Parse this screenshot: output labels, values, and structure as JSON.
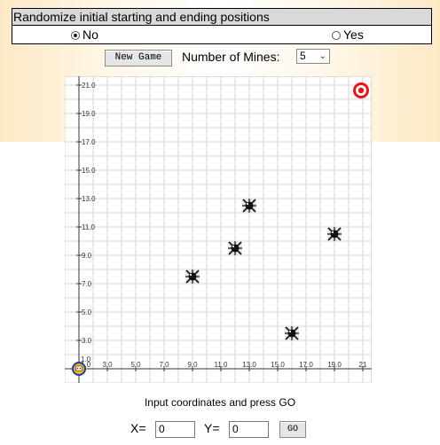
{
  "header": {
    "title": "Randomize initial starting and ending positions",
    "options": [
      {
        "label": "No",
        "checked": true
      },
      {
        "label": "Yes",
        "checked": false
      }
    ]
  },
  "toolbar": {
    "new_game_label": "New Game",
    "mines_label": "Number of Mines:",
    "mines_value": "5"
  },
  "board": {
    "x_ticks": [
      "1.0",
      "3.0",
      "5.0",
      "7.0",
      "9.0",
      "11.0",
      "13.0",
      "15.0",
      "17.0",
      "19.0",
      "21"
    ],
    "y_ticks": [
      "1.0",
      "3.0",
      "5.0",
      "7.0",
      "9.0",
      "11.0",
      "13.0",
      "15.0",
      "17.0",
      "19.0",
      "21.0"
    ],
    "mines": [
      {
        "x": 9,
        "y": 7.5
      },
      {
        "x": 12,
        "y": 9.5
      },
      {
        "x": 13,
        "y": 12.5
      },
      {
        "x": 19,
        "y": 10.5
      },
      {
        "x": 16,
        "y": 3.5
      }
    ],
    "player": {
      "x": 1,
      "y": 1
    },
    "target": {
      "x": 21,
      "y": 21
    }
  },
  "controls": {
    "instruction": "Input coordinates and press GO",
    "x_label": "X=",
    "x_value": "0",
    "y_label": "Y=",
    "y_value": "0",
    "go_label": "GO"
  },
  "colors": {
    "target": "#e8141c",
    "player": "#f2b21c",
    "grid": "#d6d6d6"
  }
}
